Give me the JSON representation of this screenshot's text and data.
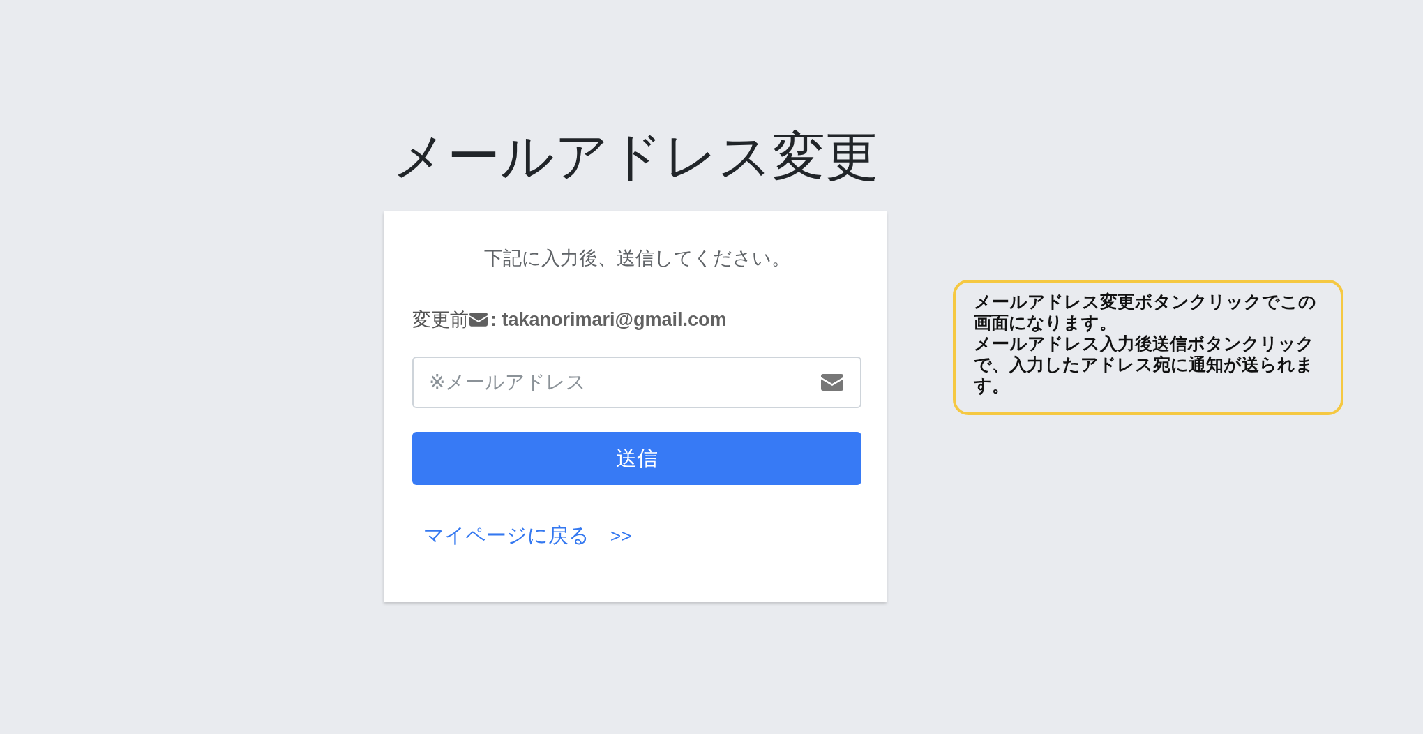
{
  "page_title": "メールアドレス変更",
  "form": {
    "instruction": "下記に入力後、送信してください。",
    "current_email": {
      "label": "変更前",
      "separator": ":",
      "value": "takanorimari@gmail.com"
    },
    "email_field": {
      "placeholder": "※メールアドレス"
    },
    "submit_button": "送信",
    "back_link": {
      "label": "マイページに戻る",
      "arrow": ">>"
    }
  },
  "annotation": {
    "paragraphs": [
      "メールアドレス変更ボタンクリックでこの画面になります。",
      "メールアドレス入力後送信ボタンクリックで、入力したアドレス宛に通知が送られます。"
    ]
  }
}
